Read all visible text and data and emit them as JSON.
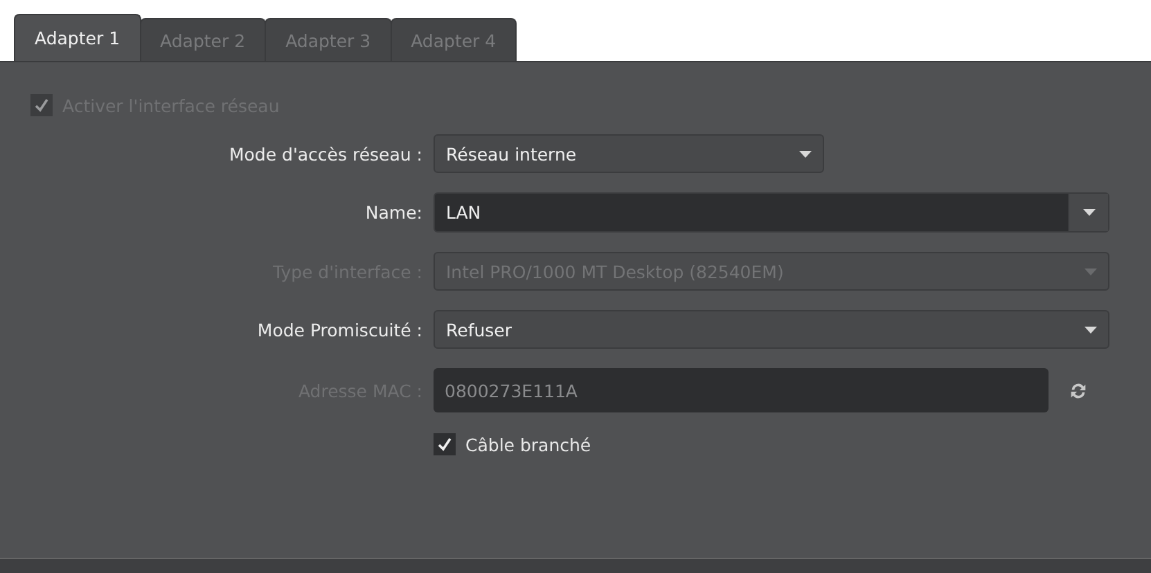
{
  "tabs": [
    {
      "label": "Adapter 1",
      "selected": true
    },
    {
      "label": "Adapter 2",
      "selected": false
    },
    {
      "label": "Adapter 3",
      "selected": false
    },
    {
      "label": "Adapter 4",
      "selected": false
    }
  ],
  "enable_checkbox": {
    "label": "Activer l'interface réseau",
    "checked": true,
    "disabled": true
  },
  "fields": [
    {
      "kind": "combo",
      "label": "Mode d'accès réseau :",
      "value": "Réseau interne",
      "disabled": false
    },
    {
      "kind": "editable-combo",
      "label": "Name:",
      "value": "LAN",
      "disabled": false
    },
    {
      "kind": "combo-wide",
      "label": "Type d'interface :",
      "value": "Intel PRO/1000 MT Desktop (82540EM)",
      "disabled": true
    },
    {
      "kind": "combo-wide",
      "label": "Mode Promiscuité :",
      "value": "Refuser",
      "disabled": false
    },
    {
      "kind": "text",
      "label": "Adresse MAC :",
      "value": "0800273E111A",
      "disabled": true
    }
  ],
  "cable_checkbox": {
    "label": "Câble branché",
    "checked": true,
    "disabled": false
  }
}
